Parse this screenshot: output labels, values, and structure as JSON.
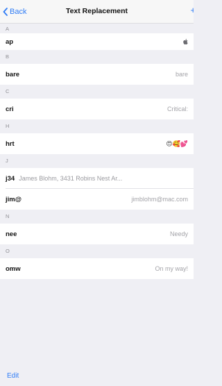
{
  "nav": {
    "back_label": "Back",
    "title": "Text Replacement",
    "add_label": "+"
  },
  "sections": [
    {
      "header": "A",
      "rows": [
        {
          "shortcut": "ap",
          "phrase": "",
          "icon": "apple-icon"
        }
      ]
    },
    {
      "header": "B",
      "rows": [
        {
          "shortcut": "bare",
          "phrase": "bare"
        }
      ]
    },
    {
      "header": "C",
      "rows": [
        {
          "shortcut": "cri",
          "phrase": "Critical:"
        }
      ]
    },
    {
      "header": "H",
      "rows": [
        {
          "shortcut": "hrt",
          "phrase": "😍🥰💕"
        }
      ]
    },
    {
      "header": "J",
      "rows": [
        {
          "shortcut": "j34",
          "phrase": "James Blohm, 3431 Robins Nest Ar..."
        },
        {
          "shortcut": "jim@",
          "phrase": "jimblohm@mac.com"
        }
      ]
    },
    {
      "header": "N",
      "rows": [
        {
          "shortcut": "nee",
          "phrase": "Needy"
        }
      ]
    },
    {
      "header": "O",
      "rows": [
        {
          "shortcut": "omw",
          "phrase": "On my way!"
        }
      ]
    }
  ],
  "footer": {
    "edit_label": "Edit"
  },
  "colors": {
    "accent": "#2f7cf6",
    "background": "#efeff4",
    "secondary_text": "#a3a3a8"
  }
}
